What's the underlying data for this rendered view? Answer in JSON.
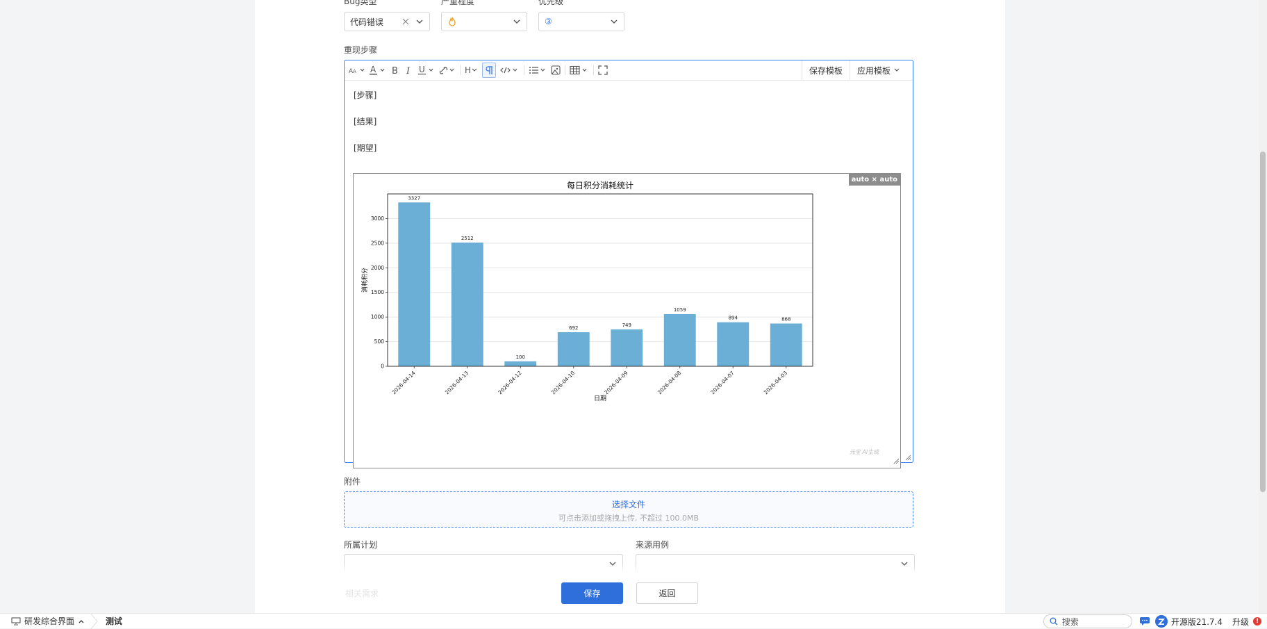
{
  "form": {
    "bug_type": {
      "label": "Bug类型",
      "value": "代码错误"
    },
    "severity": {
      "label": "严重程度"
    },
    "priority": {
      "label": "优先级",
      "value": "③"
    },
    "steps": {
      "label": "重现步骤"
    },
    "attachment": {
      "label": "附件"
    },
    "plan": {
      "label": "所属计划",
      "value": ""
    },
    "source_case": {
      "label": "来源用例",
      "value": ""
    },
    "faded_label": "相关需求"
  },
  "toolbar": {
    "heading_label": "H",
    "save_template": "保存模板",
    "apply_template": "应用模板"
  },
  "editor": {
    "paragraphs": [
      "[步骤]",
      "[结果]",
      "[期望]"
    ],
    "image_badge": "auto × auto"
  },
  "chart_data": {
    "type": "bar",
    "title": "每日积分消耗统计",
    "xlabel": "日期",
    "ylabel": "消耗积分",
    "categories": [
      "2026-04-14",
      "2026-04-13",
      "2026-04-12",
      "2026-04-10",
      "2026-04-09",
      "2026-04-08",
      "2026-04-07",
      "2026-04-03"
    ],
    "values": [
      3327,
      2512,
      100,
      692,
      749,
      1059,
      894,
      868
    ],
    "value_labels": [
      "3327",
      "2512",
      "100",
      "692",
      "749",
      "1059",
      "894",
      "868"
    ],
    "ylim": [
      0,
      3500
    ],
    "yticks": [
      0,
      500,
      1000,
      1500,
      2000,
      2500,
      3000
    ],
    "ytick_labels": [
      "0",
      "500",
      "1000",
      "1500",
      "2000",
      "2500",
      "3000"
    ],
    "grid": "horizontal",
    "bar_color": "#6baed6",
    "watermark": "元宝 AI生成"
  },
  "upload": {
    "choose": "选择文件",
    "hint": "可点击添加或拖拽上传, 不超过 100.0MB"
  },
  "buttons": {
    "save": "保存",
    "back": "返回"
  },
  "taskbar": {
    "app": "研发综合界面",
    "page": "测试",
    "search": "搜索",
    "version": "开源版21.7.4",
    "upgrade": "升级",
    "notice_count": "!"
  },
  "colors": {
    "accent": "#2f6fdc",
    "border_focus": "#3b82f6"
  }
}
